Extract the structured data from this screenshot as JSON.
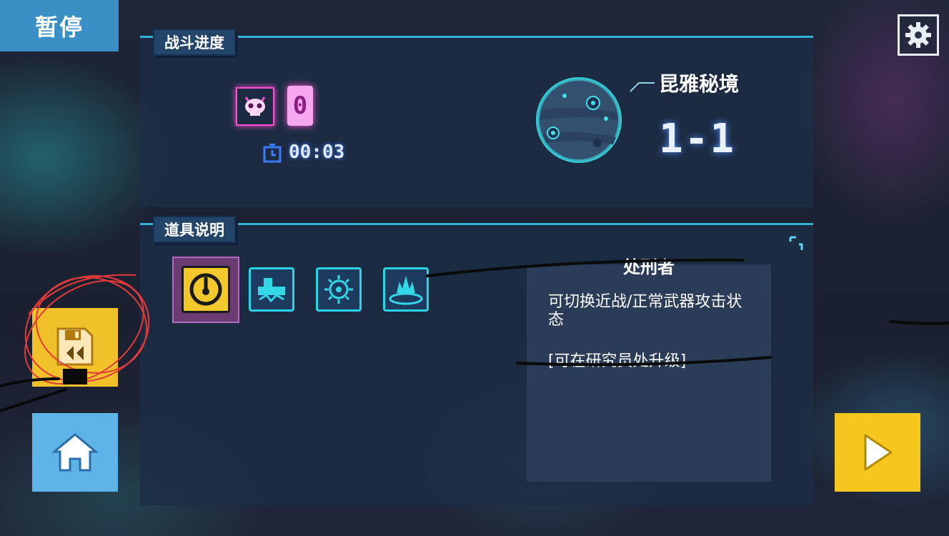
{
  "header": {
    "pause_label": "暂停"
  },
  "battle_progress": {
    "section_label": "战斗进度",
    "kill_count": "0",
    "timer": "00:03",
    "realm_name": "昆雅秘境",
    "level": "1-1"
  },
  "items": {
    "section_label": "道具说明",
    "slots": [
      {
        "icon": "power-toggle-icon",
        "selected": true
      },
      {
        "icon": "wall-block-icon",
        "selected": false
      },
      {
        "icon": "spiky-mine-icon",
        "selected": false
      },
      {
        "icon": "ground-burst-icon",
        "selected": false
      }
    ],
    "detail": {
      "title": "处刑者",
      "description": "可切换近战/正常武器攻击状态",
      "upgrade_note": "[可在研究员处升级]"
    }
  },
  "buttons": {
    "settings_icon": "gear-icon",
    "rewind_icon": "save-rewind-icon",
    "home_icon": "home-icon",
    "play_icon": "play-icon"
  },
  "colors": {
    "accent_cyan": "#2fb4d6",
    "pink_neon": "#ff4fd1",
    "yellow_button": "#f4c61e",
    "blue_button": "#5eb4e6"
  }
}
